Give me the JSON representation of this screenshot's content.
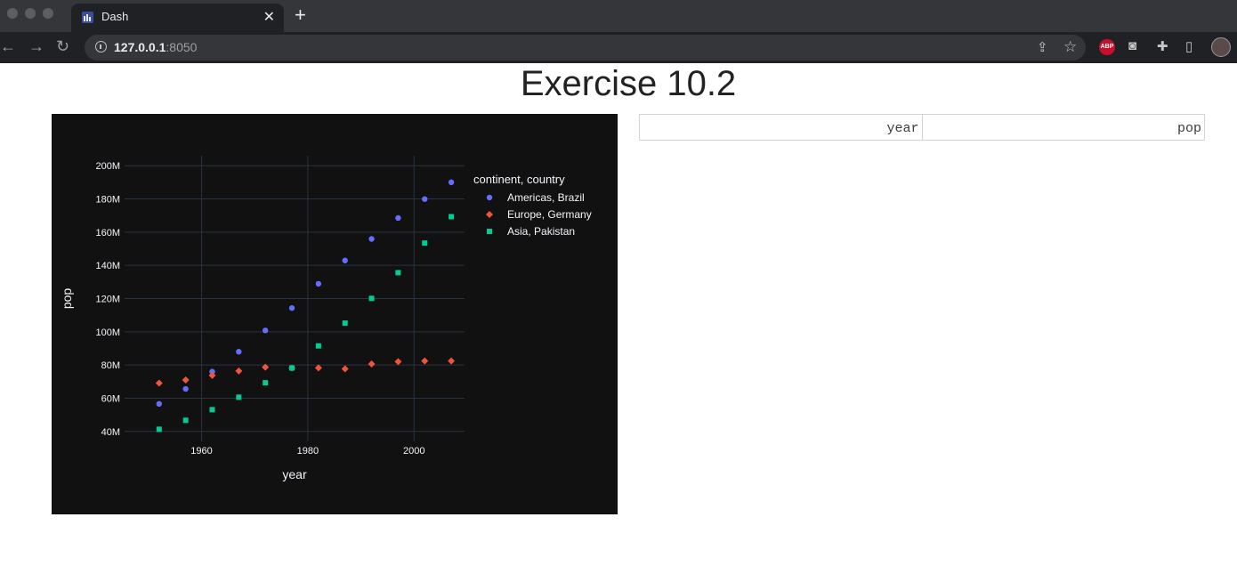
{
  "browser": {
    "tab_title": "Dash",
    "tab_close": "✕",
    "new_tab": "+",
    "url_host": "127.0.0.1",
    "url_port": ":8050",
    "abp_label": "ABP"
  },
  "page": {
    "title": "Exercise 10.2"
  },
  "table": {
    "columns": [
      "year",
      "pop"
    ]
  },
  "chart_data": {
    "type": "scatter",
    "xlabel": "year",
    "ylabel": "pop",
    "xlim": [
      1945.5,
      2009.5
    ],
    "ylim": [
      34000000,
      206000000
    ],
    "x_ticks": [
      1960,
      1980,
      2000
    ],
    "x_tick_labels": [
      "1960",
      "1980",
      "2000"
    ],
    "y_ticks": [
      40000000,
      60000000,
      80000000,
      100000000,
      120000000,
      140000000,
      160000000,
      180000000,
      200000000
    ],
    "y_tick_labels": [
      "40M",
      "60M",
      "80M",
      "100M",
      "120M",
      "140M",
      "160M",
      "180M",
      "200M"
    ],
    "grid": true,
    "legend_title": "continent, country",
    "legend_position": "top-right",
    "x": [
      1952,
      1957,
      1962,
      1967,
      1972,
      1977,
      1982,
      1987,
      1992,
      1997,
      2002,
      2007
    ],
    "series": [
      {
        "name": "Americas, Brazil",
        "color": "#636efa",
        "marker": "circle",
        "values": [
          56600000,
          65600000,
          76000000,
          88000000,
          100800000,
          114300000,
          128900000,
          142900000,
          155900000,
          168500000,
          179900000,
          190000000
        ]
      },
      {
        "name": "Europe, Germany",
        "color": "#ef553b",
        "marker": "diamond",
        "values": [
          69100000,
          71000000,
          73700000,
          76400000,
          78700000,
          78200000,
          78300000,
          77700000,
          80600000,
          82000000,
          82400000,
          82400000
        ]
      },
      {
        "name": "Asia, Pakistan",
        "color": "#00cc96",
        "marker": "square",
        "values": [
          41300000,
          46700000,
          53100000,
          60600000,
          69300000,
          78200000,
          91500000,
          105200000,
          120100000,
          135600000,
          153400000,
          169300000
        ]
      }
    ]
  }
}
